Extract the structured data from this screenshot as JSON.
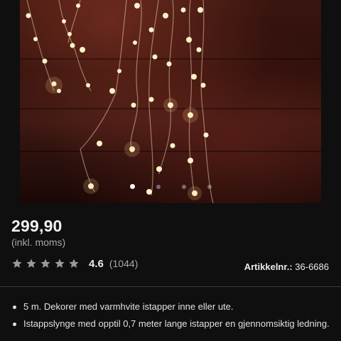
{
  "product": {
    "price": "299,90",
    "vat_note": "(inkl. moms)",
    "rating": {
      "value": "4.6",
      "count": "(1044)",
      "stars": 5,
      "star_color": "#9a9a9a"
    },
    "article_label": "Artikkelnr.:",
    "article_number": "36-6686"
  },
  "gallery": {
    "image_count": 4,
    "active_index": 0,
    "image_subject": "warm white LED icicle string lights"
  },
  "features": [
    "5 m. Dekorer med varmhvite istapper inne eller ute.",
    "Istappslynge med opptil 0,7 meter lange istapper en gjennomsiktig ledning."
  ],
  "colors": {
    "background": "#0f0f0f",
    "divider": "#3a3a3a",
    "muted_text": "#a8a8a8"
  }
}
